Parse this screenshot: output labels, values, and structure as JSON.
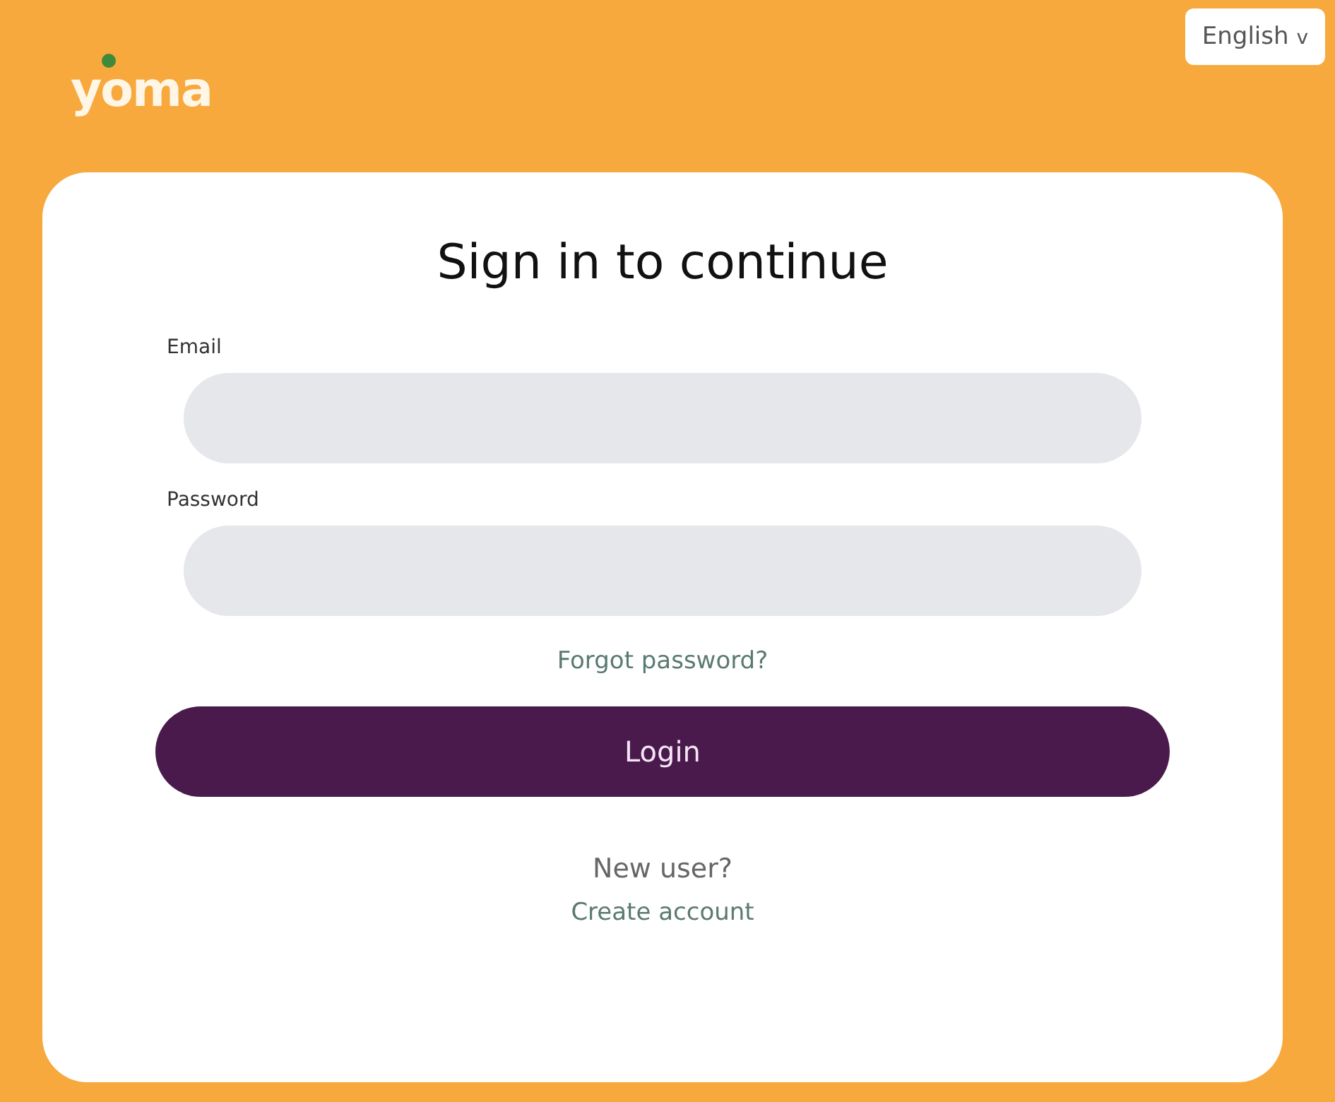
{
  "logo": "yoma",
  "language": {
    "label": "English",
    "caret": "v"
  },
  "title": "Sign in to continue",
  "fields": [
    {
      "label": "Email"
    },
    {
      "label": "Password"
    }
  ],
  "forgot_link": "Forgot password?",
  "login_button": "Login",
  "new_user": "New user?",
  "create_link": "Create account"
}
